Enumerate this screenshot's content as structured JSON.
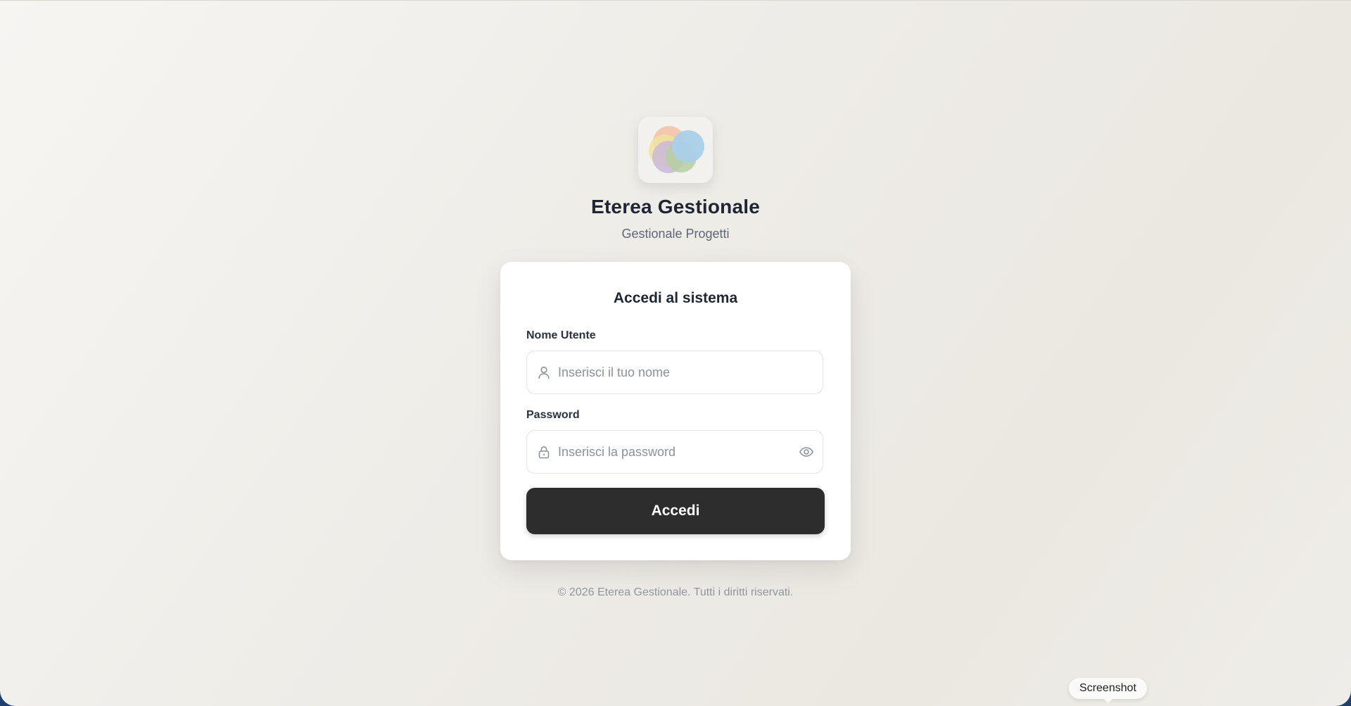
{
  "app": {
    "title": "Eterea Gestionale",
    "subtitle": "Gestionale Progetti"
  },
  "login": {
    "heading": "Accedi al sistema",
    "username": {
      "label": "Nome Utente",
      "placeholder": "Inserisci il tuo nome",
      "value": "",
      "icon": "user-icon"
    },
    "password": {
      "label": "Password",
      "placeholder": "Inserisci la password",
      "value": "",
      "icon": "lock-icon",
      "toggle_icon": "eye-icon"
    },
    "submit_label": "Accedi"
  },
  "footer": {
    "copyright": "© 2026 Eterea Gestionale. Tutti i diritti riservati."
  },
  "tooltip": {
    "label": "Screenshot"
  },
  "colors": {
    "button_bg": "#2d2d2d",
    "title_text": "#1e2533",
    "muted_text": "#8f95a1",
    "logo_circles": [
      "#f2c1a3",
      "#ede49c",
      "#cab8d8",
      "#b5cfa2",
      "#a9cfe9"
    ]
  }
}
